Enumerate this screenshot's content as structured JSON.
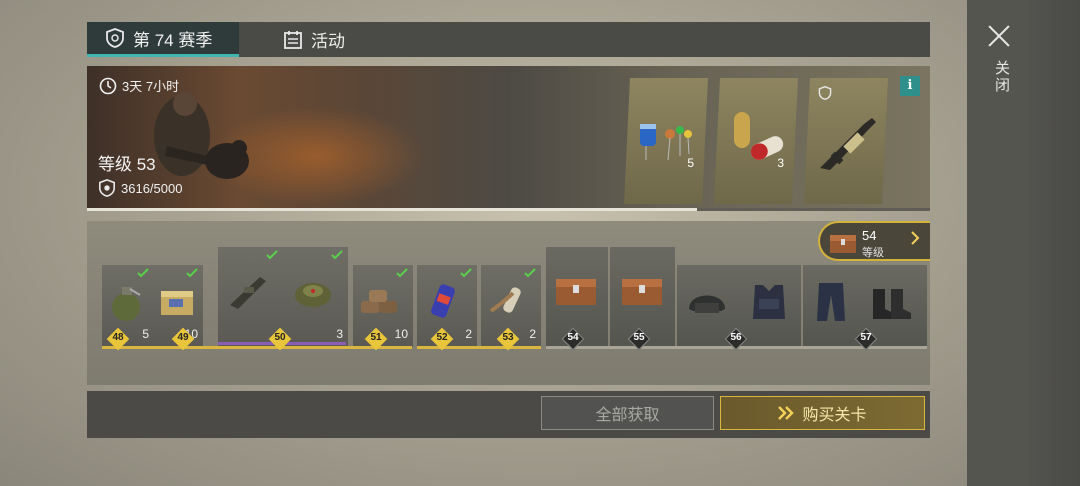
{
  "close": {
    "label": "关闭"
  },
  "tabs": {
    "season": "第 74 赛季",
    "activity": "活动"
  },
  "banner": {
    "timer": "3天 7小时",
    "level": "等级 53",
    "xp": "3616/5000",
    "xp_progress": 0.7232,
    "info": "i",
    "rewards": [
      {
        "icon": "electronic-components-icon",
        "qty": "5"
      },
      {
        "icon": "capsules-icon",
        "qty": "3"
      },
      {
        "icon": "assault-rifle-icon",
        "qty": ""
      }
    ]
  },
  "track": {
    "next_level": {
      "num": "54",
      "label": "等级"
    },
    "items": [
      {
        "icon": "grenade-icon",
        "qty": "5",
        "claimed": true
      },
      {
        "icon": "ammo-crate-icon",
        "qty": "10",
        "claimed": true
      },
      {
        "icon": "grenade-launcher-icon",
        "qty": "",
        "claimed": true
      },
      {
        "icon": "landmine-icon",
        "qty": "3",
        "claimed": true
      },
      {
        "icon": "sandbags-icon",
        "qty": "10",
        "claimed": true
      },
      {
        "icon": "energy-drink-icon",
        "qty": "2",
        "claimed": true
      },
      {
        "icon": "bandage-icon",
        "qty": "2",
        "claimed": true
      },
      {
        "icon": "loot-chest-icon",
        "qty": "",
        "claimed": false
      },
      {
        "icon": "loot-chest-icon",
        "qty": "",
        "claimed": false
      },
      {
        "icon": "helmet-icon",
        "qty": "",
        "claimed": false
      },
      {
        "icon": "tactical-vest-icon",
        "qty": "",
        "claimed": false
      },
      {
        "icon": "pants-icon",
        "qty": "",
        "claimed": false
      },
      {
        "icon": "boots-icon",
        "qty": "",
        "claimed": false
      }
    ],
    "levels": [
      "48",
      "49",
      "50",
      "51",
      "52",
      "53",
      "54",
      "55",
      "56",
      "57"
    ]
  },
  "footer": {
    "claim_all": "全部获取",
    "buy_levels": "购买关卡"
  },
  "colors": {
    "accent_teal": "#3fb6b0",
    "gold": "#d9b63f",
    "purple": "#8a5fb3"
  }
}
